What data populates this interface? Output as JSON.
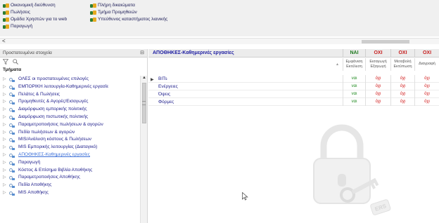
{
  "roles": {
    "col1": [
      "Οικονομική διεύθυνση",
      "Πωλήσεις",
      "Ομάδα Χρηστών για το web",
      "Παραγωγή"
    ],
    "col2": [
      "Πλήρη δικαιώματα",
      "Τμήμα Προμηθειών",
      "Υπεύθυνος καταστήματος λιανικής"
    ],
    "scroll_left": "<"
  },
  "left_panel": {
    "header": "Προστατευμένα στοιχεία",
    "pin_icon": "pin-icon",
    "filter_icon": "funnel-icon",
    "search_icon": "search-icon",
    "section_title": "Τμήματα",
    "items": [
      {
        "label": "ΟΛΕΣ οι προστατευμένες επιλογές",
        "selected": false
      },
      {
        "label": "ΕΜΠΟΡΙΚΗ λειτουργία-Καθημερινές εργασίε",
        "selected": false
      },
      {
        "label": "Πελάτες & Πωλήσεις",
        "selected": false
      },
      {
        "label": "Προμηθευτές & Αγορές/Εισαγωγές",
        "selected": false
      },
      {
        "label": "Διαμόρφωση εμπορικής πολιτικής",
        "selected": false
      },
      {
        "label": "Διαμόρφωση πιστωτικής πολιτικής",
        "selected": false
      },
      {
        "label": "Παραμετροποιήσεις πωλήσεων & αγορών",
        "selected": false
      },
      {
        "label": "Πεδία πωλήσεων & αγορών",
        "selected": false
      },
      {
        "label": "MIS/Ανάλυση κόστους & Πωλήσεων",
        "selected": false
      },
      {
        "label": "MIS Εμπορικής λειτουργίας (Διαταγικό)",
        "selected": false
      },
      {
        "label": "ΑΠΟΘΗΚΕΣ-Καθημερινές εργασίες",
        "selected": true
      },
      {
        "label": "Παραγωγή",
        "selected": false
      },
      {
        "label": "Κόστος & Επίσημα Βιβλία Αποθήκης",
        "selected": false
      },
      {
        "label": "Παραμετροποιήσεις Αποθήκης",
        "selected": false
      },
      {
        "label": "Πεδία Αποθήκης",
        "selected": false
      },
      {
        "label": "MIS Αποθήκης",
        "selected": false
      }
    ]
  },
  "right_panel": {
    "title": "ΑΠΟΘΗΚΕΣ-Καθημερινές εργασίες",
    "toggles": [
      {
        "label": "ΝΑΙ",
        "kind": "yes"
      },
      {
        "label": "ΟΧΙ",
        "kind": "no"
      },
      {
        "label": "ΟΧΙ",
        "kind": "no"
      },
      {
        "label": "ΟΧΙ",
        "kind": "no"
      }
    ],
    "columns": [
      {
        "line1": "Εμφάνιση",
        "line2": "Εκτέλεση"
      },
      {
        "line1": "Εισαγωγή",
        "line2": "Εξαγωγή"
      },
      {
        "line1": "Μεταβολή",
        "line2": "Εκτύπωση"
      },
      {
        "line1": "Διαγραφή",
        "line2": ""
      }
    ],
    "rows": [
      {
        "label": "BITs",
        "values": [
          "ναι",
          "όχι",
          "όχι",
          "όχι"
        ]
      },
      {
        "label": "Ενέργειες",
        "values": [
          "ναι",
          "όχι",
          "όχι",
          "όχι"
        ]
      },
      {
        "label": "Όψεις",
        "values": [
          "ναι",
          "όχι",
          "όχι",
          "όχι"
        ]
      },
      {
        "label": "Φόρμες",
        "values": [
          "ναι",
          "όχι",
          "όχι",
          "όχι"
        ]
      }
    ],
    "watermark_label": "ERS"
  },
  "colors": {
    "yes": "#1f7a1f",
    "no": "#c62020",
    "link": "#1c1c8a",
    "selected": "#3b6fd8"
  }
}
